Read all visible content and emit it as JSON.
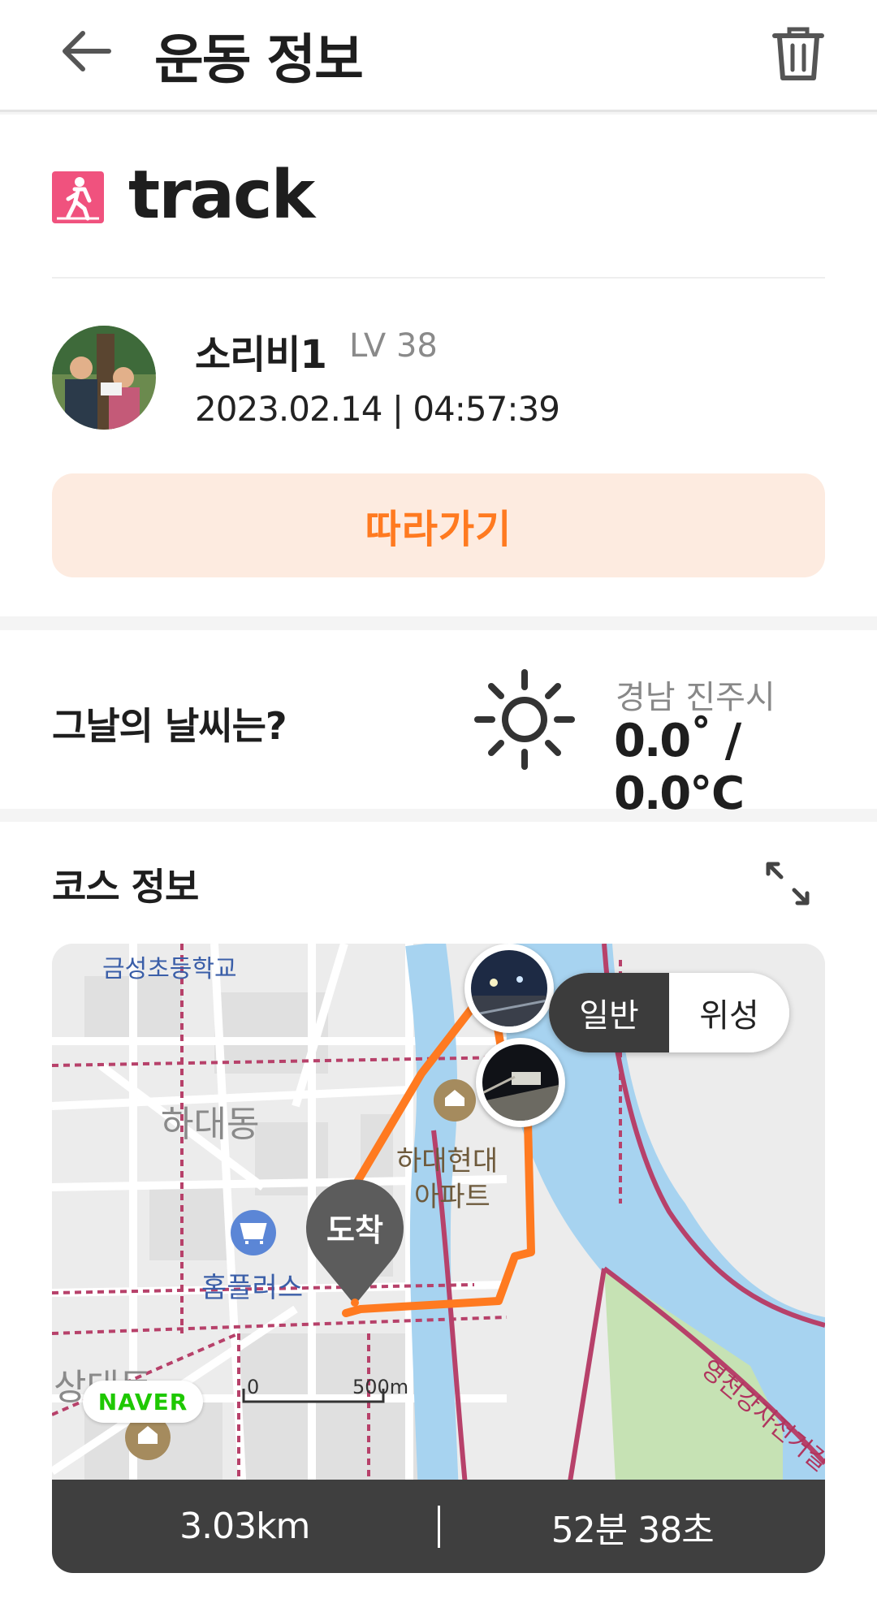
{
  "header": {
    "title": "운동 정보",
    "back_icon": "arrow-left-icon",
    "delete_icon": "trash-icon"
  },
  "activity": {
    "type_icon": "walking-icon",
    "type_color": "#f0527e",
    "title": "track"
  },
  "user": {
    "name": "소리비1",
    "level": "LV 38",
    "datetime": "2023.02.14 | 04:57:39"
  },
  "follow_button": {
    "label": "따라가기",
    "bg": "#fdebe0",
    "color": "#ff7a20"
  },
  "weather": {
    "question": "그날의 날씨는?",
    "icon": "sun-icon",
    "location": "경남 진주시",
    "temperature": "0.0˚ / 0.0℃"
  },
  "course": {
    "title": "코스 정보",
    "expand_icon": "expand-icon",
    "map_mode": {
      "options": [
        "일반",
        "위성"
      ],
      "selected": "일반"
    },
    "arrival_label": "도착",
    "map_labels": {
      "school": "금성초등학교",
      "district1": "하대동",
      "apt_line1": "하대현대",
      "apt_line2": "아파트",
      "mart": "홈플러스",
      "district2": "상대동",
      "bike_road": "영천강자전거길"
    },
    "naver_logo": "NAVER",
    "scale": {
      "zero": "0",
      "max": "500m"
    },
    "route_color": "#ff7a20",
    "distance": "3.03km",
    "duration": "52분 38초"
  }
}
